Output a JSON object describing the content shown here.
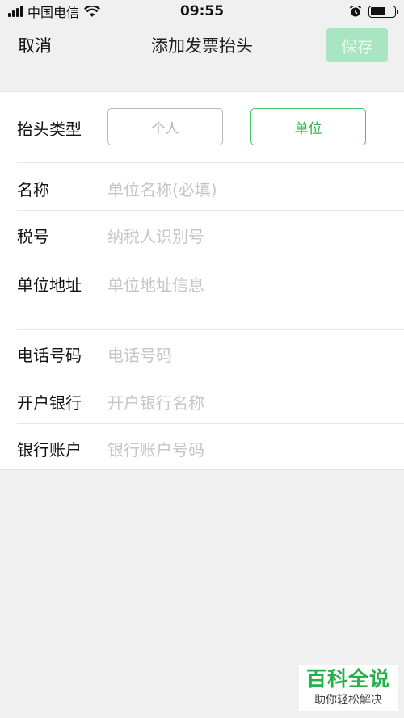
{
  "status_bar": {
    "carrier": "中国电信",
    "time": "09:55"
  },
  "nav": {
    "cancel_label": "取消",
    "title": "添加发票抬头",
    "save_label": "保存"
  },
  "form": {
    "type_row": {
      "label": "抬头类型",
      "options": [
        "个人",
        "单位"
      ],
      "selected": "单位"
    },
    "fields": [
      {
        "label": "名称",
        "placeholder": "单位名称(必填)"
      },
      {
        "label": "税号",
        "placeholder": "纳税人识别号"
      },
      {
        "label": "单位地址",
        "placeholder": "单位地址信息"
      },
      {
        "label": "电话号码",
        "placeholder": "电话号码"
      },
      {
        "label": "开户银行",
        "placeholder": "开户银行名称"
      },
      {
        "label": "银行账户",
        "placeholder": "银行账户号码"
      }
    ]
  },
  "watermark": {
    "main": "百科全说",
    "sub": "助你轻松解决"
  },
  "colors": {
    "accent_green": "#3fc85f",
    "save_disabled_bg": "#a8e5c0",
    "background": "#f0f0f0"
  },
  "status_icons": [
    "signal-icon",
    "wifi-icon",
    "alarm-icon",
    "battery-icon"
  ]
}
